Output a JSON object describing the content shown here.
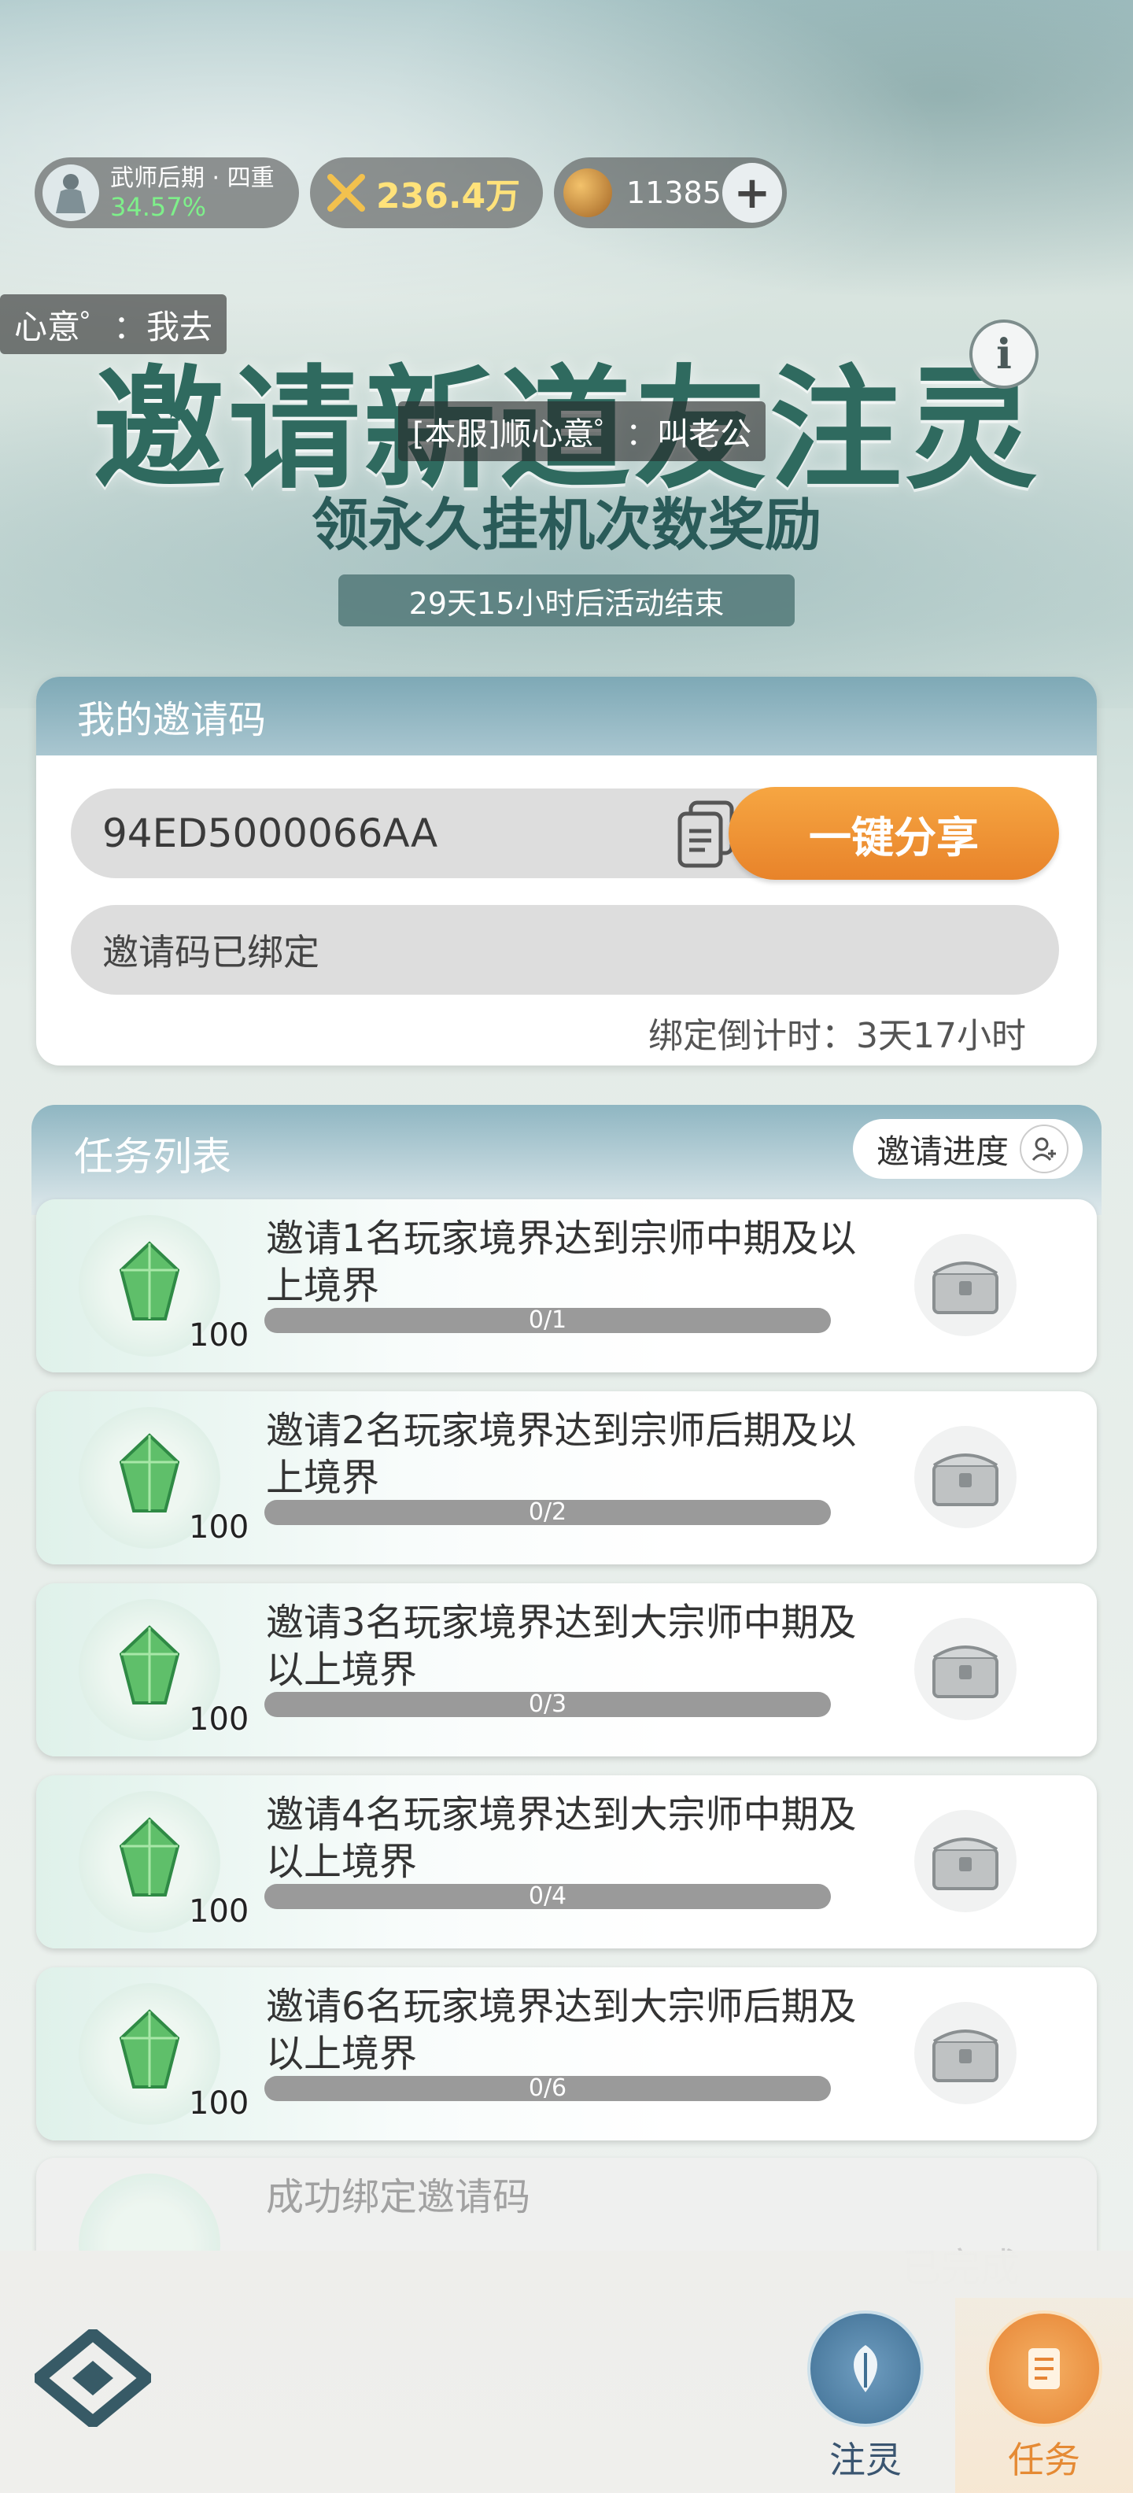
{
  "status": {
    "realm_name": "武师后期 · 四重",
    "realm_progress": "34.57%",
    "power": "236.4万",
    "coins": "11385",
    "add_label": "+"
  },
  "chat": {
    "bubble_left": "心意゜：我去",
    "bubble_center": "[本服]顺心意゜：叫老公"
  },
  "hero": {
    "title": "邀请新道友注灵",
    "subtitle": "领永久挂机次数奖励",
    "countdown": "29天15小时后活动结束",
    "info_label": "i"
  },
  "invite": {
    "header": "我的邀请码",
    "code": "94ED5000066AA",
    "share_label": "一键分享",
    "bound_text": "邀请码已绑定",
    "bind_countdown": "绑定倒计时：3天17小时"
  },
  "tasks": {
    "header": "任务列表",
    "progress_label": "邀请进度",
    "items": [
      {
        "text": "邀请1名玩家境界达到宗师中期及以上境界",
        "reward": "100",
        "progress": "0/1",
        "ratio": 0
      },
      {
        "text": "邀请2名玩家境界达到宗师后期及以上境界",
        "reward": "100",
        "progress": "0/2",
        "ratio": 0
      },
      {
        "text": "邀请3名玩家境界达到大宗师中期及以上境界",
        "reward": "100",
        "progress": "0/3",
        "ratio": 0
      },
      {
        "text": "邀请4名玩家境界达到大宗师中期及以上境界",
        "reward": "100",
        "progress": "0/4",
        "ratio": 0
      },
      {
        "text": "邀请6名玩家境界达到大宗师后期及以上境界",
        "reward": "100",
        "progress": "0/6",
        "ratio": 0
      }
    ],
    "completed": {
      "text": "成功绑定邀请码",
      "status": "已完成"
    }
  },
  "nav": {
    "tab_lingzhu": "注灵",
    "tab_task": "任务",
    "active_color": "#e58a34"
  }
}
